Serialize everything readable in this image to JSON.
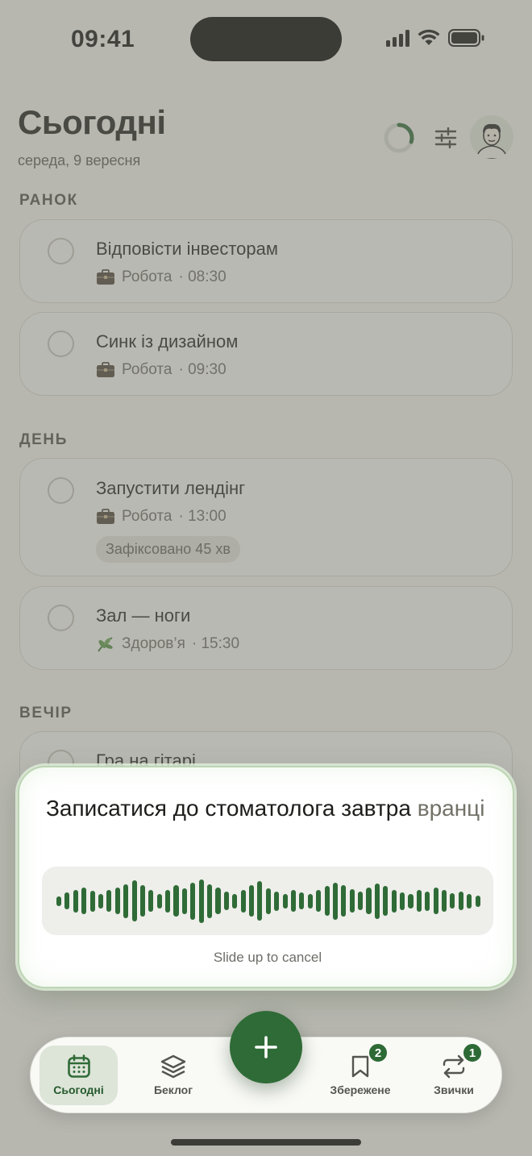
{
  "status_bar": {
    "time": "09:41"
  },
  "header": {
    "title": "Сьогодні",
    "date": "середа, 9 вересня",
    "progress": 0.3
  },
  "sections": [
    {
      "label": "РАНОК",
      "tasks": [
        {
          "title": "Відповісти інвесторам",
          "category": "Робота",
          "category_icon": "briefcase-icon",
          "time": "· 08:30"
        },
        {
          "title": "Синк із дизайном",
          "category": "Робота",
          "category_icon": "briefcase-icon",
          "time": "· 09:30"
        }
      ]
    },
    {
      "label": "ДЕНЬ",
      "tasks": [
        {
          "title": "Запустити лендінг",
          "category": "Робота",
          "category_icon": "briefcase-icon",
          "time": "· 13:00",
          "chip": "Зафіксовано 45 хв"
        },
        {
          "title": "Зал — ноги",
          "category": "Здоров’я",
          "category_icon": "leaf-icon",
          "time": "· 15:30"
        }
      ]
    },
    {
      "label": "ВЕЧІР",
      "tasks": [
        {
          "title": "Гра на гітарі"
        }
      ]
    }
  ],
  "voice_input": {
    "transcript_confirmed": "Записатися до стоматолога завтра",
    "transcript_pending": "вранці",
    "cancel_hint": "Slide up to cancel",
    "wave_levels": [
      0.22,
      0.38,
      0.52,
      0.62,
      0.48,
      0.34,
      0.5,
      0.62,
      0.78,
      0.95,
      0.72,
      0.5,
      0.34,
      0.52,
      0.72,
      0.6,
      0.86,
      1.0,
      0.78,
      0.62,
      0.42,
      0.34,
      0.52,
      0.72,
      0.9,
      0.6,
      0.45,
      0.34,
      0.5,
      0.38,
      0.34,
      0.5,
      0.68,
      0.86,
      0.72,
      0.54,
      0.42,
      0.62,
      0.82,
      0.68,
      0.52,
      0.4,
      0.34,
      0.5,
      0.44,
      0.62,
      0.5,
      0.36,
      0.42,
      0.34,
      0.26
    ],
    "accent": "#2f6b37"
  },
  "tab_bar": {
    "tabs": [
      {
        "label": "Сьогодні",
        "icon": "calendar-icon",
        "active": true
      },
      {
        "label": "Беклог",
        "icon": "layers-icon"
      },
      {
        "label": "Збережене",
        "icon": "bookmark-icon",
        "badge": "2"
      },
      {
        "label": "Звички",
        "icon": "repeat-icon",
        "badge": "1"
      }
    ],
    "fab_icon": "plus-icon"
  },
  "colors": {
    "accent": "#2f6b37",
    "background": "#f6f6f3",
    "card": "#fbfbf9"
  }
}
